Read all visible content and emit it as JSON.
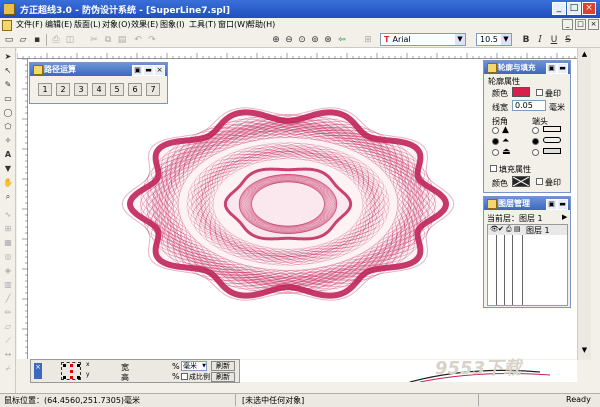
{
  "window": {
    "title": "方正超线3.0 - 防伪设计系统 - [SuperLine7.spl]",
    "controls": [
      "_",
      "□",
      "×"
    ]
  },
  "menu": [
    "文件(F)",
    "编辑(E)",
    "版面(L)",
    "对象(O)",
    "效果(E)",
    "图象(I)",
    "工具(T)",
    "窗口(W)",
    "帮助(H)"
  ],
  "toolbar": {
    "font_name": "Arial",
    "font_size": "10.5",
    "bold": "B",
    "italic": "I",
    "underline": "U",
    "strike": "S"
  },
  "path_panel": {
    "title": "路径运算",
    "buttons": [
      "1",
      "2",
      "3",
      "4",
      "5",
      "6",
      "7"
    ]
  },
  "fill_panel": {
    "title": "轮廓与填充",
    "outline_section": "轮廓属性",
    "color_label": "颜色",
    "overprint_label": "叠印",
    "width_label": "线宽",
    "width_value": "0.05",
    "width_unit": "毫米",
    "corner_label": "拐角",
    "cap_label": "端头",
    "fill_section": "填充属性",
    "fill_color_label": "颜色",
    "fill_overprint_label": "叠印",
    "outline_color": "#d81e4b"
  },
  "layer_panel": {
    "title": "图层管理",
    "current_layer_label": "当前层：",
    "current_layer_value": "图层 1",
    "layer_name": "图层 1"
  },
  "transform_bar": {
    "width_label": "宽",
    "height_label": "高",
    "percent": "%",
    "unit": "毫米",
    "apply1": "刷新",
    "apply2": "刷新",
    "proportion": "成比例"
  },
  "status": {
    "position": "鼠标位置：(64.4560,251.7305)毫米",
    "selection": "[未选中任何对象]",
    "ready": "Ready"
  },
  "watermark": "9553下载",
  "colors": {
    "guilloche": "#c1245a",
    "title_bar": "#2a5fcf",
    "accent": "#d81e4b"
  }
}
